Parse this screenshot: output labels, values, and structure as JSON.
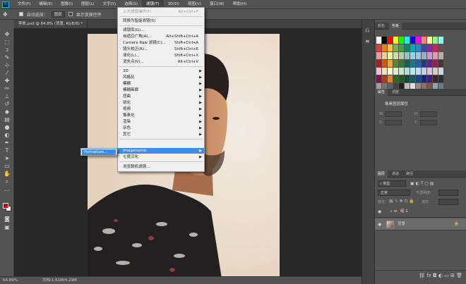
{
  "menubar": {
    "logo": "Ps",
    "items": [
      "文件(F)",
      "编辑(E)",
      "图像(I)",
      "图层(L)",
      "文字(Y)",
      "选择(S)",
      "滤镜(T)",
      "3D(D)",
      "视图(V)",
      "窗口(W)",
      "帮助(H)"
    ]
  },
  "options": {
    "auto_select": "自动选择：",
    "auto_select_value": "图层",
    "show_transform": "显示变换控件"
  },
  "document": {
    "tab_title": "李凯.psd @ 64.8% (背景, RGB/8) *",
    "zoom": "64.89%",
    "doc_info": "文档:1.61M/4.29M"
  },
  "filter_menu": {
    "items": [
      {
        "label": "上次滤镜操作(F)",
        "shortcut": "Alt+Ctrl+F",
        "disabled": true
      },
      {
        "label": "转换为智能滤镜(S)"
      },
      {
        "label": "滤镜库(G)..."
      },
      {
        "label": "自适应广角(A)...",
        "shortcut": "Alt+Shift+Ctrl+A"
      },
      {
        "label": "Camera Raw 滤镜(C)...",
        "shortcut": "Shift+Ctrl+A"
      },
      {
        "label": "镜头校正(R)...",
        "shortcut": "Shift+Ctrl+R"
      },
      {
        "label": "液化(L)...",
        "shortcut": "Shift+Ctrl+X"
      },
      {
        "label": "消失点(V)...",
        "shortcut": "Alt+Ctrl+V"
      },
      {
        "label": "3D",
        "submenu": true
      },
      {
        "label": "风格化",
        "submenu": true
      },
      {
        "label": "模糊",
        "submenu": true
      },
      {
        "label": "模糊画廊",
        "submenu": true
      },
      {
        "label": "扭曲",
        "submenu": true
      },
      {
        "label": "锐化",
        "submenu": true
      },
      {
        "label": "视频",
        "submenu": true
      },
      {
        "label": "像素化",
        "submenu": true
      },
      {
        "label": "渲染",
        "submenu": true
      },
      {
        "label": "杂色",
        "submenu": true
      },
      {
        "label": "其它",
        "submenu": true
      },
      {
        "label": "Imagenomic",
        "submenu": true,
        "highlight": true
      },
      {
        "label": "七度汉化",
        "submenu": true
      },
      {
        "label": "浏览联机滤镜..."
      }
    ],
    "submenu_item": "Portraiture..."
  },
  "panels": {
    "swatch_tabs": [
      "颜色",
      "色板"
    ],
    "props_tabs": [
      "属性",
      "调整"
    ],
    "props_title": "像素图层属性",
    "props_fields": [
      "W:",
      "H:",
      "X:",
      "Y:"
    ],
    "layers_tabs": [
      "图层",
      "通道",
      "路径"
    ],
    "kind_filter": "类型",
    "blend_mode": "正常",
    "opacity_label": "不透明度:",
    "fill_label": "填充:",
    "lock_label": "锁定:",
    "layers": [
      {
        "name": "组 1",
        "type": "group"
      },
      {
        "name": "背景",
        "type": "pixel",
        "selected": true
      }
    ]
  },
  "colors": {
    "accent": "#3a8ee6",
    "fg": "#d10000",
    "bg": "#ffffff"
  }
}
